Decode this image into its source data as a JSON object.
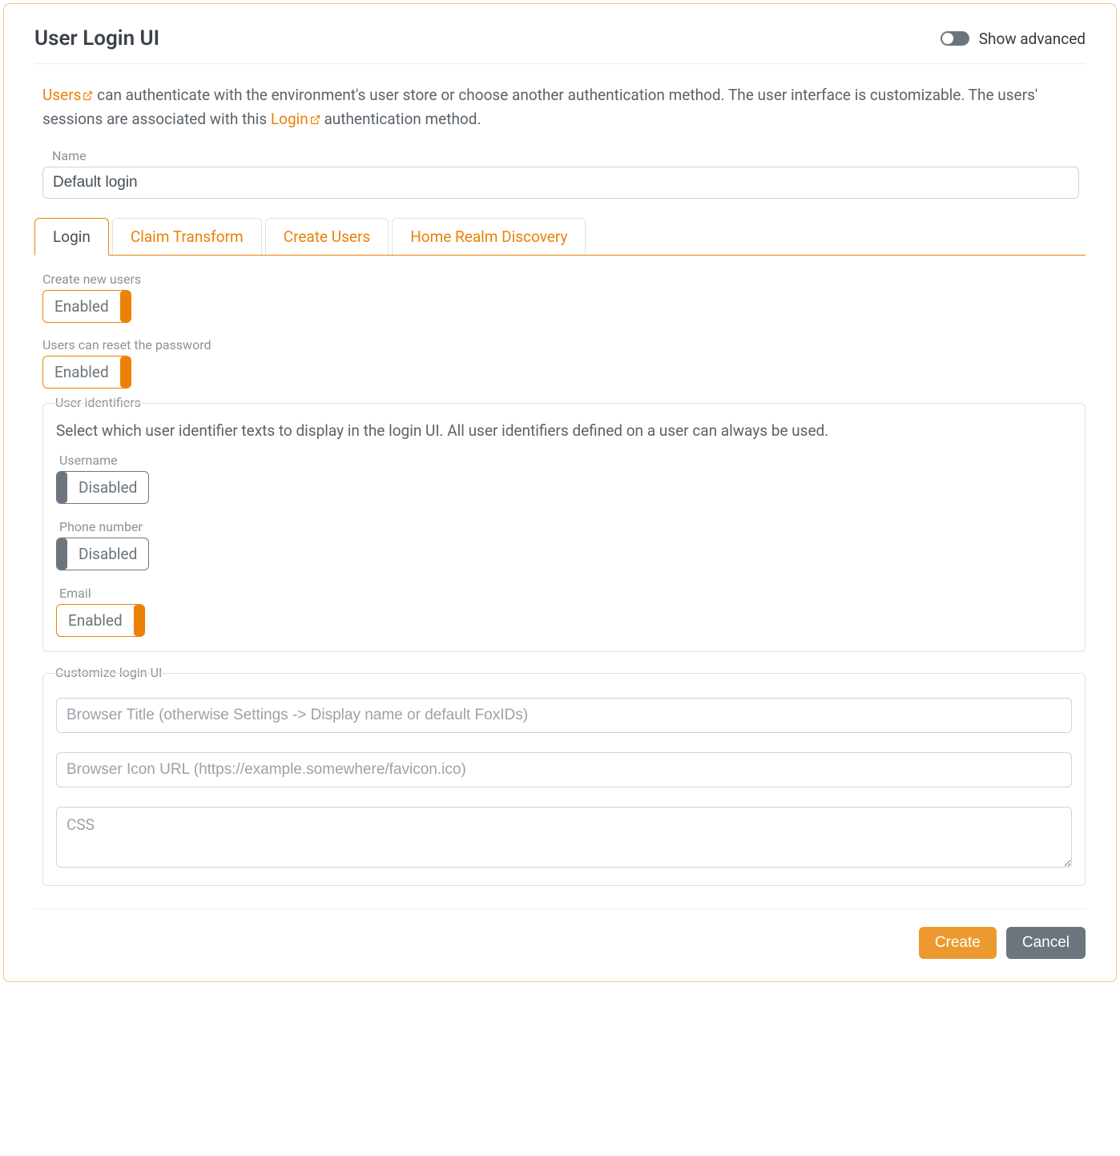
{
  "header": {
    "title": "User Login UI",
    "show_advanced_label": "Show advanced"
  },
  "intro": {
    "users_link": "Users",
    "text1": " can authenticate with the environment's user store or choose another authentication method. The user interface is customizable. The users' sessions are associated with this ",
    "login_link": "Login",
    "text2": " authentication method."
  },
  "name": {
    "label": "Name",
    "value": "Default login"
  },
  "tabs": [
    {
      "label": "Login"
    },
    {
      "label": "Claim Transform"
    },
    {
      "label": "Create Users"
    },
    {
      "label": "Home Realm Discovery"
    }
  ],
  "login_tab": {
    "create_new_users": {
      "label": "Create new users",
      "state": "Enabled"
    },
    "reset_password": {
      "label": "Users can reset the password",
      "state": "Enabled"
    },
    "user_identifiers": {
      "legend": "User identifiers",
      "description": "Select which user identifier texts to display in the login UI. All user identifiers defined on a user can always be used.",
      "username": {
        "label": "Username",
        "state": "Disabled"
      },
      "phone": {
        "label": "Phone number",
        "state": "Disabled"
      },
      "email": {
        "label": "Email",
        "state": "Enabled"
      }
    },
    "customize": {
      "legend": "Customize login UI",
      "browser_title_placeholder": "Browser Title (otherwise Settings -> Display name or default FoxIDs)",
      "browser_icon_placeholder": "Browser Icon URL (https://example.somewhere/favicon.ico)",
      "css_placeholder": "CSS"
    }
  },
  "footer": {
    "create": "Create",
    "cancel": "Cancel"
  }
}
